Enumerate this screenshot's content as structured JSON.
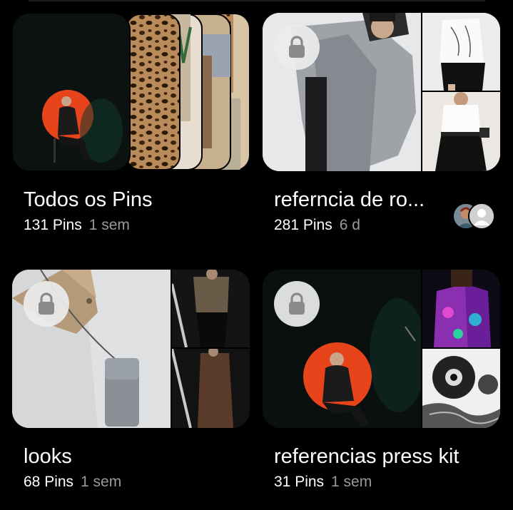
{
  "boards": [
    {
      "title": "Todos os Pins",
      "count": "131 Pins",
      "age": "1 sem",
      "locked": false
    },
    {
      "title": "referncia de ro...",
      "count": "281 Pins",
      "age": "6 d",
      "locked": true,
      "collaborators": 2
    },
    {
      "title": "looks",
      "count": "68 Pins",
      "age": "1 sem",
      "locked": true
    },
    {
      "title": "referencias press kit",
      "count": "31 Pins",
      "age": "1 sem",
      "locked": true
    }
  ],
  "icons": {
    "lock": "lock-icon",
    "person": "person-icon"
  },
  "colors": {
    "background": "#000000",
    "secondary_text": "#9a9a9a",
    "lock_bg": "#ececec",
    "accent_circle": "#e8441c"
  }
}
